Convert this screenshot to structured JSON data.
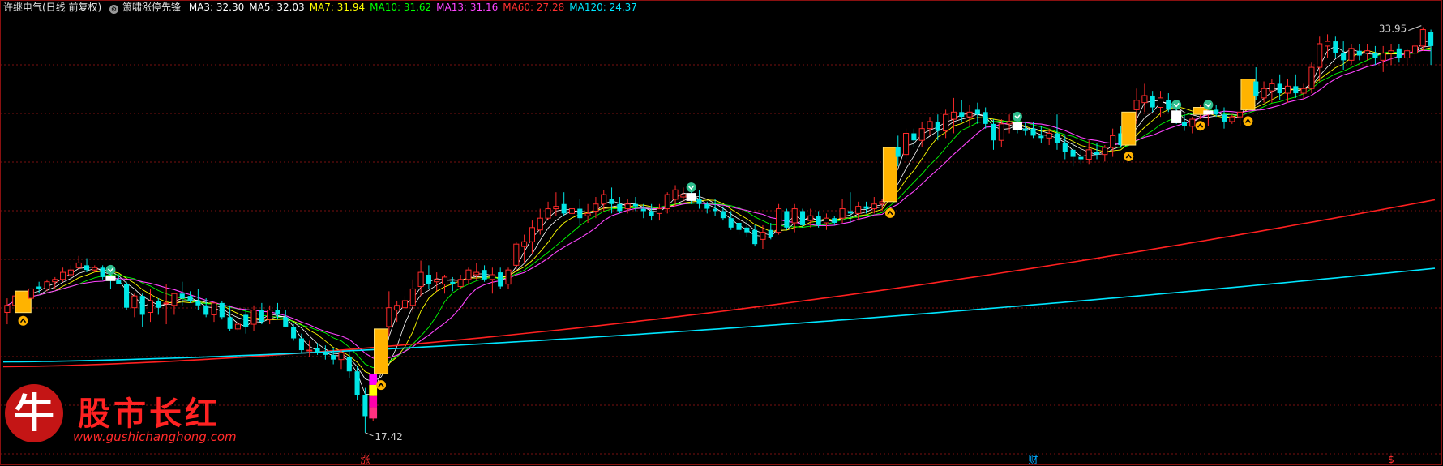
{
  "header": {
    "stock_name": "许继电气(日线 前复权)",
    "indicator_name": "箫啸涨停先锋",
    "ma_items": [
      {
        "label": "MA3: 32.30",
        "color": "#ffffff"
      },
      {
        "label": "MA5: 32.03",
        "color": "#ffffff"
      },
      {
        "label": "MA7: 31.94",
        "color": "#ffff00"
      },
      {
        "label": "MA10: 31.62",
        "color": "#00ff00"
      },
      {
        "label": "MA13: 31.16",
        "color": "#ff44ff"
      },
      {
        "label": "MA60: 27.28",
        "color": "#ff3030"
      },
      {
        "label": "MA120: 24.37",
        "color": "#00e6ff"
      }
    ]
  },
  "chart_data": {
    "type": "candlestick",
    "ylim": [
      16.5,
      35.0
    ],
    "price_labels": {
      "high": "33.95",
      "low": "17.42"
    },
    "bottom_markers": [
      {
        "text": "涨",
        "color": "#ff3030",
        "index": 45
      },
      {
        "text": "财",
        "color": "#00aaff",
        "index": 129
      },
      {
        "text": "$",
        "color": "#ff3030",
        "index": 174
      }
    ],
    "colors": {
      "up": "#ff2a2a",
      "down": "#00e6e6",
      "grid": "#7a1010"
    },
    "candles": [
      [
        22.5,
        22.0,
        23.1,
        22.8,
        0
      ],
      [
        22.8,
        22.7,
        23.3,
        23.2,
        0
      ],
      [
        22.7,
        22.7,
        23.2,
        23.2,
        3
      ],
      [
        23.1,
        23.1,
        23.5,
        23.5,
        0
      ],
      [
        23.6,
        23.3,
        23.8,
        23.5,
        0
      ],
      [
        23.5,
        23.4,
        23.9,
        23.8,
        0
      ],
      [
        23.8,
        23.5,
        24.0,
        23.9,
        0
      ],
      [
        23.9,
        23.8,
        24.4,
        24.2,
        0
      ],
      [
        24.1,
        24.0,
        24.5,
        24.3,
        0
      ],
      [
        24.4,
        24.3,
        24.9,
        24.6,
        0
      ],
      [
        24.5,
        24.2,
        24.8,
        24.3,
        0
      ],
      [
        24.3,
        24.2,
        24.5,
        24.4,
        0
      ],
      [
        24.4,
        23.9,
        24.5,
        24.0,
        0
      ],
      [
        24.0,
        23.5,
        24.2,
        23.9,
        2
      ],
      [
        23.9,
        23.7,
        24.1,
        23.7,
        0
      ],
      [
        23.7,
        22.6,
        23.8,
        22.7,
        0
      ],
      [
        22.7,
        22.3,
        23.3,
        23.2,
        0
      ],
      [
        23.2,
        21.9,
        23.3,
        22.4,
        0
      ],
      [
        22.5,
        22.1,
        23.5,
        23.0,
        0
      ],
      [
        23.0,
        22.4,
        23.1,
        22.7,
        0
      ],
      [
        22.9,
        22.0,
        23.7,
        22.9,
        0
      ],
      [
        22.8,
        22.4,
        23.3,
        23.3,
        0
      ],
      [
        23.3,
        22.8,
        23.8,
        23.1,
        0
      ],
      [
        23.2,
        22.9,
        23.4,
        23.0,
        0
      ],
      [
        23.0,
        22.6,
        23.5,
        22.8,
        0
      ],
      [
        22.8,
        22.3,
        23.1,
        22.4,
        0
      ],
      [
        22.4,
        22.1,
        22.9,
        22.9,
        0
      ],
      [
        22.9,
        22.2,
        23.0,
        22.3,
        0
      ],
      [
        22.3,
        21.7,
        22.8,
        21.8,
        0
      ],
      [
        21.8,
        21.7,
        22.8,
        22.0,
        0
      ],
      [
        22.4,
        21.6,
        22.7,
        21.9,
        0
      ],
      [
        22.0,
        21.7,
        22.8,
        22.6,
        0
      ],
      [
        22.6,
        22.0,
        22.9,
        22.1,
        0
      ],
      [
        22.2,
        22.0,
        22.8,
        22.6,
        0
      ],
      [
        22.6,
        22.2,
        22.9,
        22.4,
        0
      ],
      [
        22.3,
        21.9,
        22.6,
        21.9,
        0
      ],
      [
        21.9,
        21.3,
        22.0,
        21.4,
        0
      ],
      [
        21.4,
        20.8,
        21.6,
        20.9,
        0
      ],
      [
        20.9,
        20.6,
        21.3,
        20.9,
        0
      ],
      [
        21.0,
        20.7,
        21.2,
        20.8,
        0
      ],
      [
        20.8,
        20.5,
        21.1,
        20.7,
        0
      ],
      [
        20.7,
        20.3,
        21.0,
        20.5,
        0
      ],
      [
        20.5,
        20.1,
        20.9,
        20.8,
        0
      ],
      [
        20.6,
        19.7,
        20.9,
        20.0,
        0
      ],
      [
        20.0,
        18.8,
        20.2,
        19.0,
        0
      ],
      [
        19.0,
        17.4,
        19.3,
        18.1,
        0
      ],
      [
        18.0,
        17.9,
        19.9,
        19.9,
        4
      ],
      [
        19.9,
        19.9,
        21.8,
        21.8,
        1
      ],
      [
        21.9,
        21.5,
        23.4,
        22.7,
        0
      ],
      [
        22.6,
        22.1,
        23.0,
        22.8,
        0
      ],
      [
        22.7,
        22.4,
        23.2,
        23.0,
        0
      ],
      [
        22.8,
        22.5,
        23.9,
        23.5,
        0
      ],
      [
        23.6,
        23.2,
        24.7,
        24.2,
        0
      ],
      [
        24.1,
        23.5,
        24.5,
        23.7,
        0
      ],
      [
        23.8,
        23.4,
        24.2,
        23.9,
        0
      ],
      [
        23.7,
        23.3,
        24.1,
        24.0,
        0
      ],
      [
        23.8,
        23.4,
        24.0,
        23.7,
        0
      ],
      [
        23.6,
        23.5,
        24.1,
        23.9,
        0
      ],
      [
        23.9,
        23.7,
        24.4,
        24.3,
        0
      ],
      [
        24.1,
        23.9,
        24.6,
        24.2,
        0
      ],
      [
        24.3,
        23.8,
        24.5,
        23.9,
        0
      ],
      [
        23.9,
        23.3,
        24.4,
        24.1,
        0
      ],
      [
        24.2,
        23.5,
        24.4,
        23.6,
        0
      ],
      [
        23.7,
        23.5,
        24.4,
        24.3,
        0
      ],
      [
        24.5,
        24.2,
        25.5,
        25.4,
        0
      ],
      [
        25.3,
        24.6,
        25.8,
        25.5,
        0
      ],
      [
        25.5,
        25.0,
        26.4,
        26.1,
        0
      ],
      [
        26.0,
        25.8,
        26.9,
        26.5,
        0
      ],
      [
        26.5,
        26.4,
        27.2,
        26.9,
        0
      ],
      [
        26.9,
        26.6,
        27.6,
        27.0,
        0
      ],
      [
        27.1,
        26.6,
        27.6,
        26.7,
        0
      ],
      [
        26.7,
        26.3,
        27.2,
        26.9,
        0
      ],
      [
        26.9,
        26.2,
        27.3,
        26.5,
        0
      ],
      [
        26.6,
        26.3,
        27.1,
        26.7,
        0
      ],
      [
        26.8,
        26.5,
        27.4,
        27.1,
        0
      ],
      [
        27.1,
        26.8,
        27.7,
        27.5,
        0
      ],
      [
        27.3,
        26.7,
        27.8,
        27.1,
        0
      ],
      [
        27.1,
        26.7,
        27.4,
        26.8,
        0
      ],
      [
        26.9,
        26.7,
        27.3,
        27.1,
        0
      ],
      [
        27.1,
        26.8,
        27.4,
        27.0,
        0
      ],
      [
        26.9,
        26.5,
        27.1,
        26.8,
        0
      ],
      [
        26.8,
        26.4,
        27.1,
        26.6,
        0
      ],
      [
        26.7,
        26.4,
        27.1,
        26.9,
        0
      ],
      [
        26.9,
        26.7,
        27.6,
        27.5,
        0
      ],
      [
        27.3,
        27.0,
        27.9,
        27.7,
        0
      ],
      [
        27.4,
        27.2,
        27.8,
        27.5,
        0
      ],
      [
        27.5,
        27.1,
        27.7,
        27.3,
        2
      ],
      [
        27.3,
        26.9,
        27.7,
        27.1,
        0
      ],
      [
        27.1,
        26.7,
        27.2,
        26.9,
        0
      ],
      [
        26.9,
        26.6,
        27.3,
        26.8,
        0
      ],
      [
        26.8,
        26.4,
        27.0,
        26.5,
        0
      ],
      [
        26.5,
        26.0,
        26.8,
        26.1,
        0
      ],
      [
        26.3,
        25.8,
        26.8,
        26.0,
        0
      ],
      [
        26.1,
        25.7,
        26.4,
        25.9,
        0
      ],
      [
        26.0,
        25.3,
        26.2,
        25.4,
        0
      ],
      [
        25.6,
        25.2,
        26.2,
        25.9,
        0
      ],
      [
        26.0,
        25.6,
        26.3,
        25.7,
        0
      ],
      [
        25.9,
        25.8,
        27.1,
        26.9,
        0
      ],
      [
        26.8,
        26.0,
        26.9,
        26.1,
        0
      ],
      [
        26.3,
        25.9,
        27.1,
        26.9,
        0
      ],
      [
        26.8,
        26.1,
        26.9,
        26.2,
        0
      ],
      [
        26.4,
        26.1,
        26.9,
        26.6,
        0
      ],
      [
        26.6,
        26.1,
        26.8,
        26.2,
        0
      ],
      [
        26.3,
        26.0,
        26.7,
        26.5,
        0
      ],
      [
        26.5,
        26.2,
        26.6,
        26.3,
        0
      ],
      [
        26.5,
        26.3,
        27.3,
        26.9,
        0
      ],
      [
        26.8,
        26.3,
        27.6,
        26.7,
        0
      ],
      [
        26.7,
        26.4,
        27.2,
        27.0,
        0
      ],
      [
        27.0,
        26.7,
        27.2,
        26.9,
        0
      ],
      [
        26.9,
        26.7,
        27.4,
        27.1,
        0
      ],
      [
        27.1,
        26.8,
        27.3,
        27.2,
        0
      ],
      [
        27.2,
        27.2,
        29.5,
        29.5,
        1
      ],
      [
        29.5,
        28.7,
        30.0,
        29.1,
        0
      ],
      [
        29.2,
        29.0,
        30.3,
        30.1,
        0
      ],
      [
        30.1,
        29.5,
        30.3,
        29.8,
        0
      ],
      [
        29.8,
        29.5,
        30.6,
        30.3,
        0
      ],
      [
        30.3,
        30.0,
        30.8,
        30.6,
        0
      ],
      [
        30.6,
        29.8,
        30.9,
        30.2,
        0
      ],
      [
        30.2,
        29.9,
        31.1,
        30.9,
        0
      ],
      [
        30.7,
        30.1,
        31.6,
        31.0,
        0
      ],
      [
        31.0,
        30.6,
        31.5,
        30.8,
        0
      ],
      [
        30.8,
        30.4,
        31.3,
        31.0,
        0
      ],
      [
        31.1,
        30.5,
        31.4,
        30.9,
        0
      ],
      [
        31.0,
        30.3,
        31.2,
        30.5,
        0
      ],
      [
        30.5,
        29.4,
        30.7,
        29.8,
        0
      ],
      [
        29.8,
        29.5,
        30.7,
        30.5,
        0
      ],
      [
        30.5,
        30.1,
        30.9,
        30.6,
        0
      ],
      [
        30.5,
        30.1,
        30.8,
        30.3,
        2
      ],
      [
        30.3,
        30.0,
        30.6,
        30.2,
        0
      ],
      [
        30.3,
        29.9,
        30.6,
        30.0,
        0
      ],
      [
        30.0,
        29.7,
        30.4,
        29.9,
        0
      ],
      [
        29.9,
        29.6,
        30.3,
        30.1,
        0
      ],
      [
        30.1,
        29.4,
        30.9,
        29.7,
        0
      ],
      [
        29.7,
        29.0,
        30.0,
        29.3,
        0
      ],
      [
        29.4,
        28.7,
        29.8,
        29.1,
        0
      ],
      [
        29.1,
        28.8,
        29.4,
        29.0,
        0
      ],
      [
        29.0,
        28.8,
        29.8,
        29.4,
        0
      ],
      [
        29.3,
        29.0,
        29.7,
        29.2,
        0
      ],
      [
        29.2,
        28.9,
        29.6,
        29.5,
        0
      ],
      [
        29.5,
        29.1,
        30.3,
        30.0,
        0
      ],
      [
        30.1,
        29.5,
        30.4,
        29.6,
        0
      ],
      [
        29.6,
        29.6,
        31.0,
        31.0,
        1
      ],
      [
        31.1,
        30.5,
        32.0,
        31.5,
        0
      ],
      [
        31.4,
        31.0,
        32.2,
        31.7,
        0
      ],
      [
        31.7,
        31.0,
        31.9,
        31.2,
        0
      ],
      [
        31.2,
        30.8,
        31.9,
        31.6,
        0
      ],
      [
        31.5,
        31.0,
        31.8,
        31.1,
        0
      ],
      [
        31.0,
        30.5,
        31.2,
        30.6,
        2
      ],
      [
        30.6,
        30.2,
        30.9,
        30.4,
        0
      ],
      [
        30.4,
        30.1,
        30.8,
        30.7,
        0
      ],
      [
        30.9,
        30.7,
        31.3,
        31.2,
        1
      ],
      [
        31.0,
        30.4,
        31.1,
        31.0,
        2
      ],
      [
        31.1,
        30.8,
        31.3,
        30.9,
        0
      ],
      [
        30.9,
        30.3,
        31.2,
        30.6,
        0
      ],
      [
        30.6,
        30.5,
        30.9,
        30.8,
        0
      ],
      [
        30.8,
        30.4,
        31.2,
        31.0,
        0
      ],
      [
        31.1,
        31.0,
        32.4,
        32.4,
        1
      ],
      [
        32.3,
        31.5,
        32.9,
        31.7,
        0
      ],
      [
        31.6,
        31.4,
        32.3,
        32.0,
        0
      ],
      [
        31.9,
        31.4,
        32.4,
        32.2,
        0
      ],
      [
        32.2,
        31.5,
        32.6,
        31.8,
        0
      ],
      [
        31.8,
        31.4,
        32.4,
        32.1,
        0
      ],
      [
        32.1,
        31.6,
        32.6,
        31.8,
        0
      ],
      [
        31.8,
        31.5,
        32.2,
        32.0,
        0
      ],
      [
        32.0,
        31.8,
        33.1,
        32.9,
        0
      ],
      [
        32.9,
        32.3,
        34.2,
        33.9,
        0
      ],
      [
        33.8,
        33.3,
        34.3,
        34.0,
        0
      ],
      [
        34.0,
        33.3,
        34.2,
        33.5,
        0
      ],
      [
        33.5,
        32.8,
        34.0,
        33.2,
        0
      ],
      [
        33.2,
        33.0,
        33.9,
        33.7,
        0
      ],
      [
        33.6,
        33.2,
        33.9,
        33.4,
        0
      ],
      [
        33.5,
        33.2,
        33.9,
        33.6,
        0
      ],
      [
        33.5,
        33.0,
        33.8,
        33.3,
        0
      ],
      [
        33.2,
        32.7,
        33.8,
        33.5,
        0
      ],
      [
        33.5,
        33.0,
        33.9,
        33.6,
        0
      ],
      [
        33.7,
        33.1,
        33.9,
        33.3,
        0
      ],
      [
        33.3,
        33.0,
        33.7,
        33.6,
        0
      ],
      [
        33.5,
        33.0,
        34.0,
        33.8,
        0
      ],
      [
        33.8,
        33.6,
        34.6,
        34.5,
        0
      ],
      [
        34.4,
        33.0,
        34.5,
        33.8,
        0
      ]
    ]
  }
}
